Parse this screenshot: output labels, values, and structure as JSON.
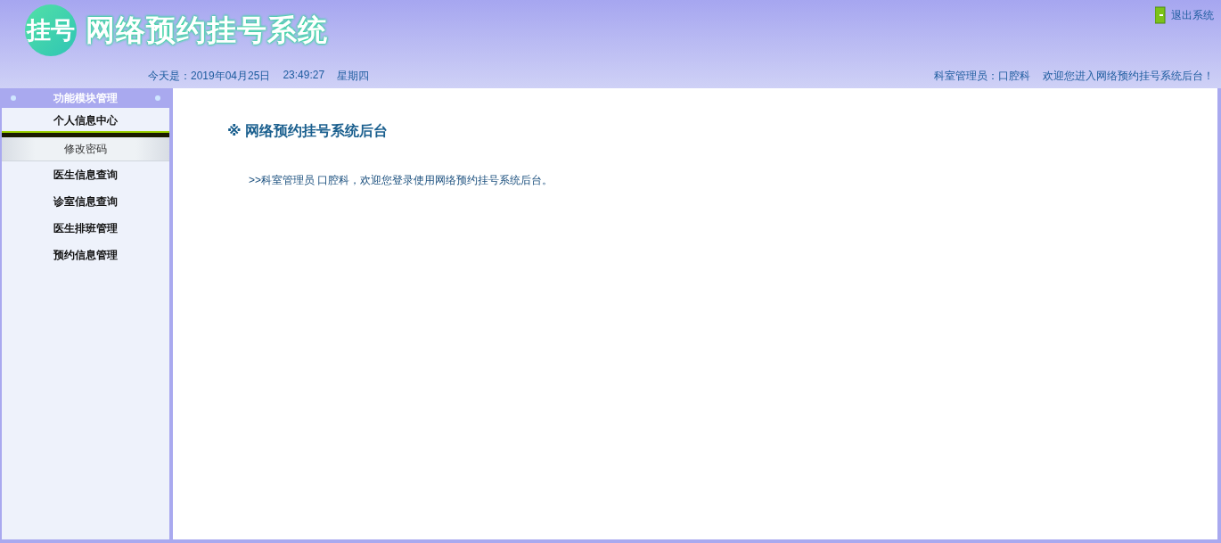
{
  "header": {
    "logo_text": "挂号",
    "title": "网络预约挂号系统",
    "logout": "退出系统",
    "date": "今天是：2019年04月25日",
    "time": "23:49:27",
    "weekday": "星期四",
    "user": "科室管理员：口腔科",
    "welcome": "欢迎您进入网络预约挂号系统后台！"
  },
  "sidebar": {
    "title": "功能模块管理",
    "items": [
      {
        "label": "个人信息中心",
        "expanded": true,
        "children": [
          {
            "label": "修改密码"
          }
        ]
      },
      {
        "label": "医生信息查询",
        "expanded": false
      },
      {
        "label": "诊室信息查询",
        "expanded": false
      },
      {
        "label": "医生排班管理",
        "expanded": false
      },
      {
        "label": "预约信息管理",
        "expanded": false
      }
    ]
  },
  "main": {
    "heading": "※ 网络预约挂号系统后台",
    "message": ">>科室管理员 口腔科，欢迎您登录使用网络预约挂号系统后台。"
  }
}
